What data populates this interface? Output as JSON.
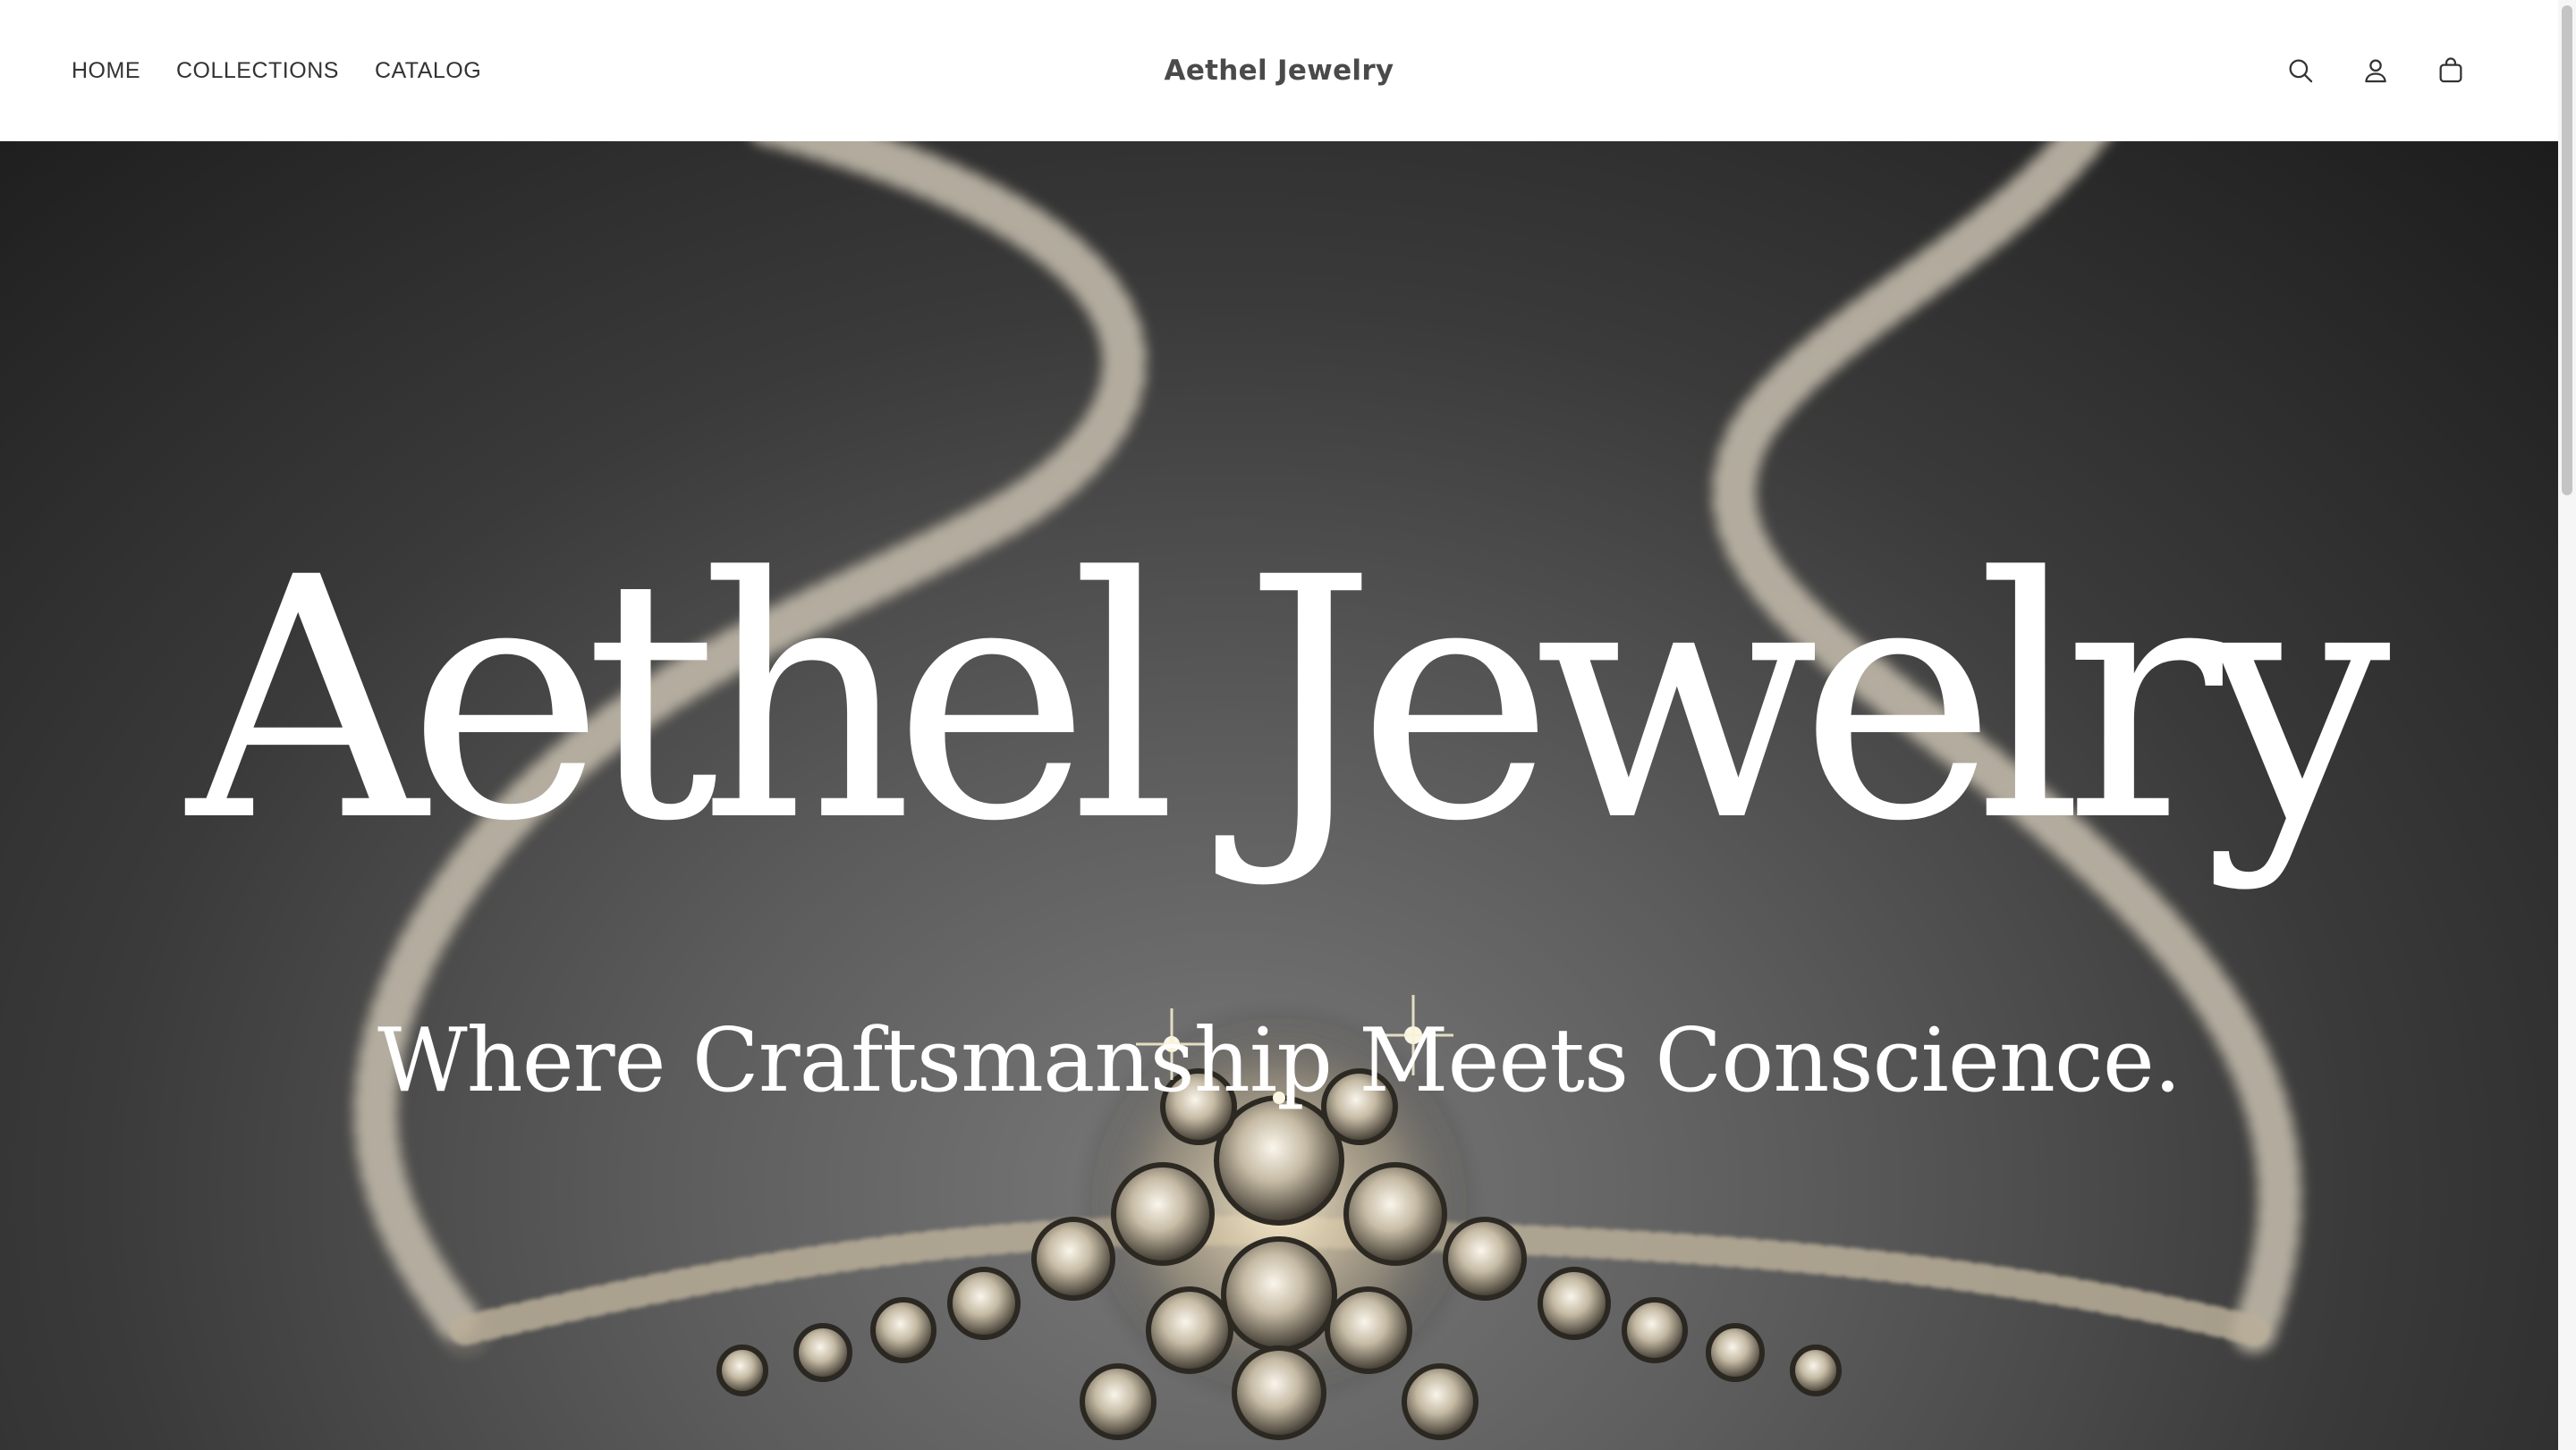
{
  "header": {
    "nav": [
      {
        "label": "HOME"
      },
      {
        "label": "COLLECTIONS"
      },
      {
        "label": "CATALOG"
      }
    ],
    "brand": "Aethel Jewelry",
    "icons": [
      "search-icon",
      "account-icon",
      "cart-icon"
    ]
  },
  "hero": {
    "title": "Aethel Jewelry",
    "subtitle": "Where Craftsmanship Meets Conscience."
  },
  "colors": {
    "header_bg": "#ffffff",
    "nav_text": "#333333",
    "brand_text": "#4a4a4a",
    "hero_text": "#ffffff",
    "hero_bg": "#3a3a3a"
  }
}
